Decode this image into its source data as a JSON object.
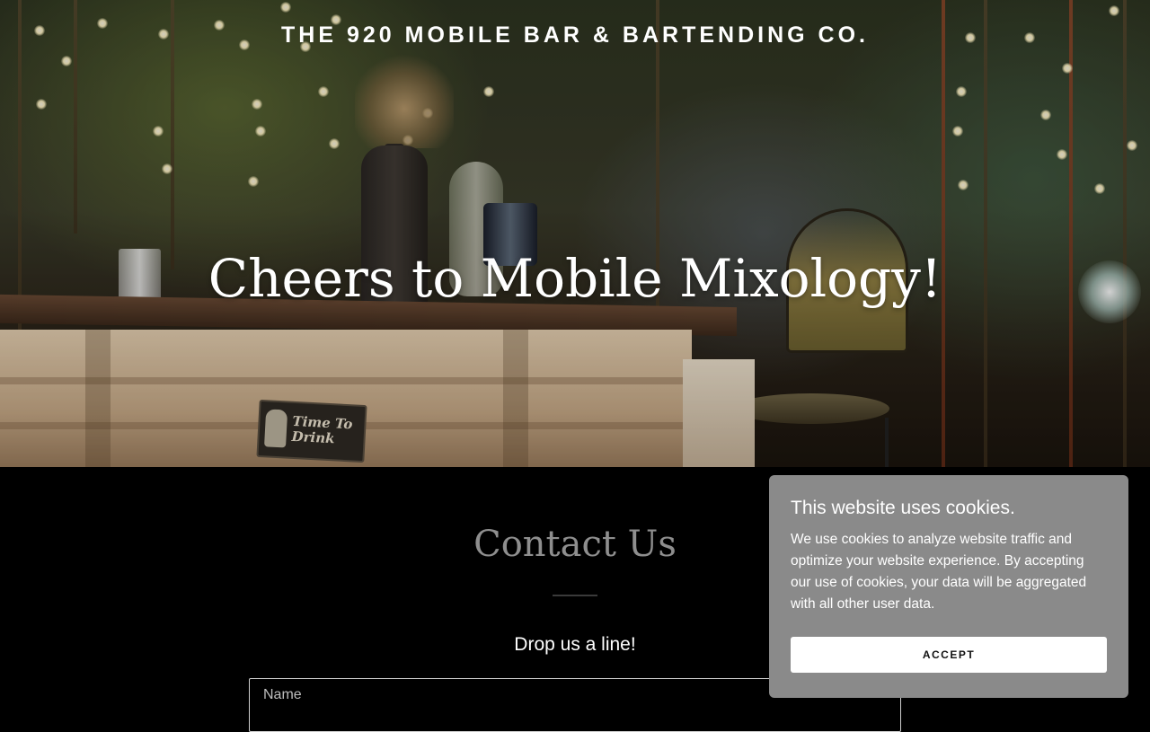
{
  "header": {
    "brand": "THE 920 MOBILE BAR & BARTENDING CO."
  },
  "hero": {
    "title": "Cheers to Mobile Mixology!",
    "sign_text": "Time To Drink"
  },
  "contact": {
    "title": "Contact Us",
    "subtitle": "Drop us a line!",
    "name_placeholder": "Name"
  },
  "cookie_banner": {
    "title": "This website uses cookies.",
    "body": "We use cookies to analyze website traffic and optimize your website experience. By accepting our use of cookies, your data will be aggregated with all other user data.",
    "accept_label": "ACCEPT"
  },
  "colors": {
    "page_bg": "#000000",
    "cookie_bg": "#8a8a8a",
    "contact_title": "#8e8e8e",
    "text": "#ffffff"
  }
}
